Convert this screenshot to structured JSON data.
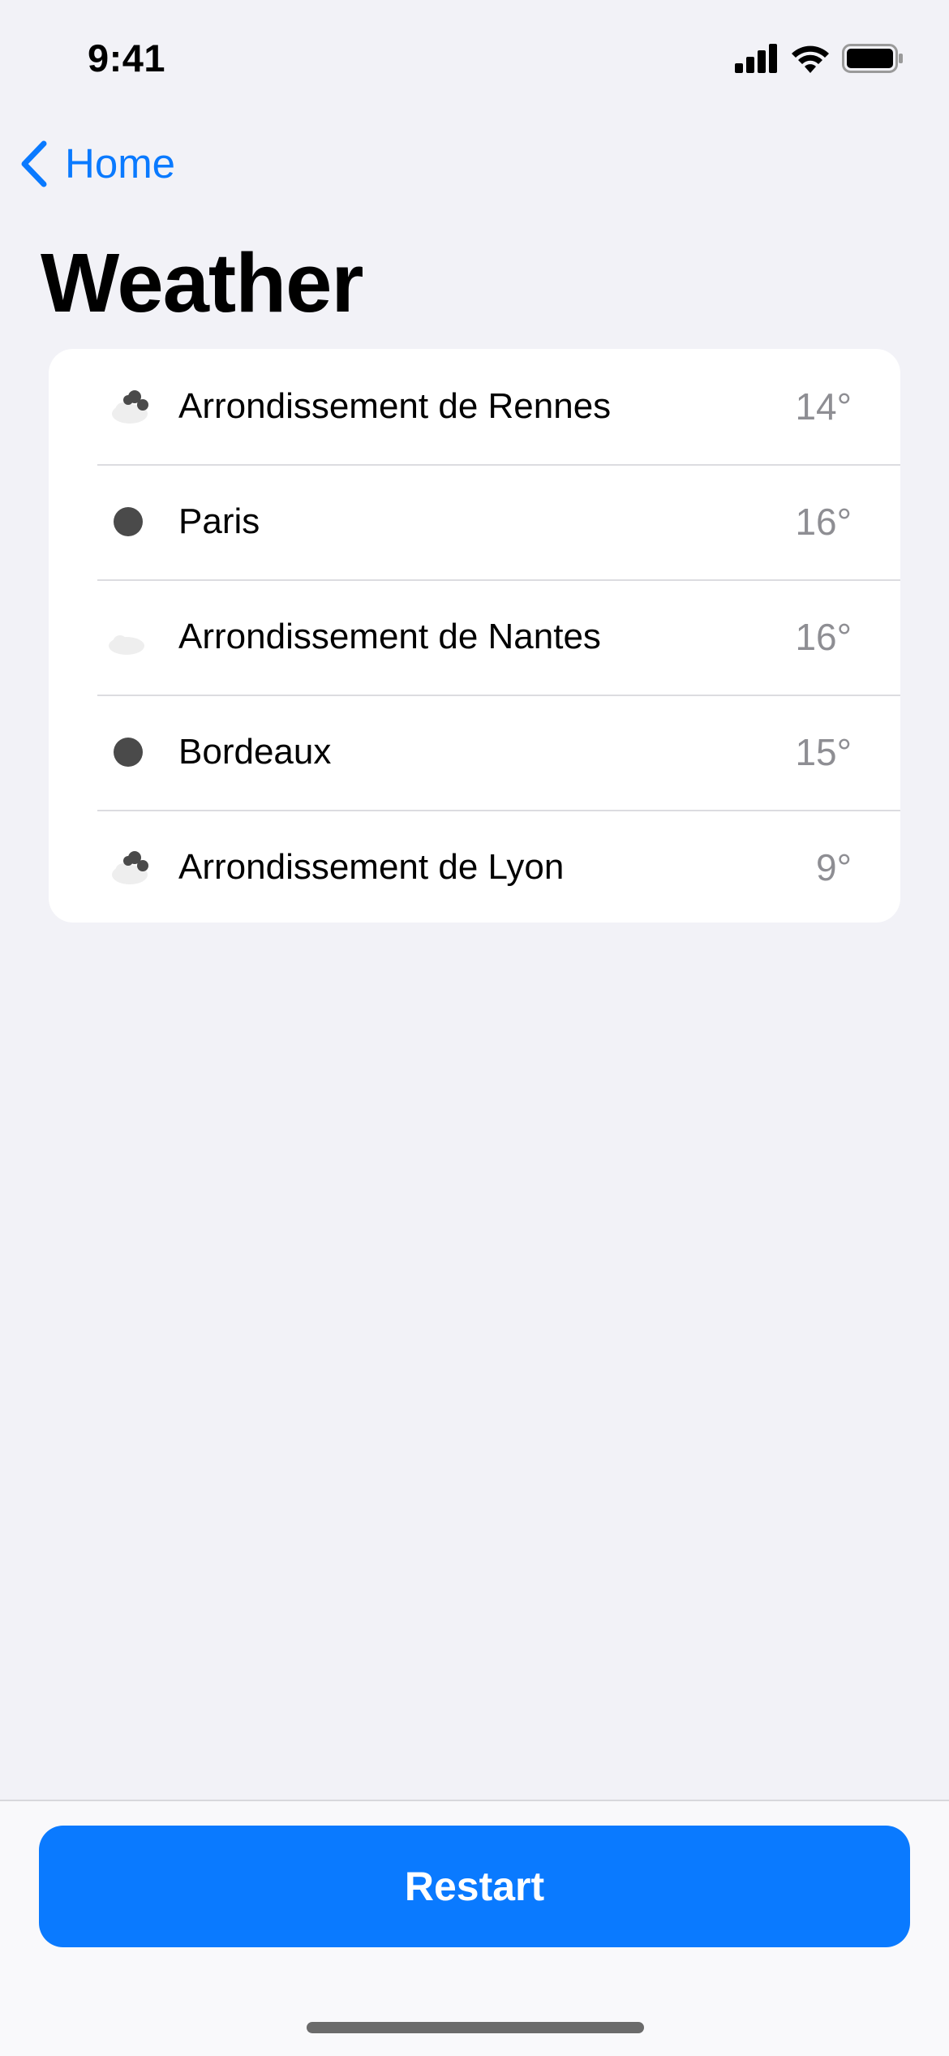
{
  "status_bar": {
    "time": "9:41"
  },
  "nav": {
    "back_label": "Home"
  },
  "page": {
    "title": "Weather"
  },
  "locations": [
    {
      "name": "Arrondissement de Rennes",
      "temp": "14°",
      "icon": "cloud-icon"
    },
    {
      "name": "Paris",
      "temp": "16°",
      "icon": "moon-icon"
    },
    {
      "name": "Arrondissement de Nantes",
      "temp": "16°",
      "icon": "partly-cloudy-night-icon"
    },
    {
      "name": "Bordeaux",
      "temp": "15°",
      "icon": "moon-icon"
    },
    {
      "name": "Arrondissement de Lyon",
      "temp": "9°",
      "icon": "cloud-icon"
    }
  ],
  "footer": {
    "restart_label": "Restart"
  },
  "colors": {
    "accent": "#0a7aff",
    "background": "#f2f2f7",
    "secondary_text": "#8e8e93",
    "icon_dark": "#4a4a4a"
  }
}
